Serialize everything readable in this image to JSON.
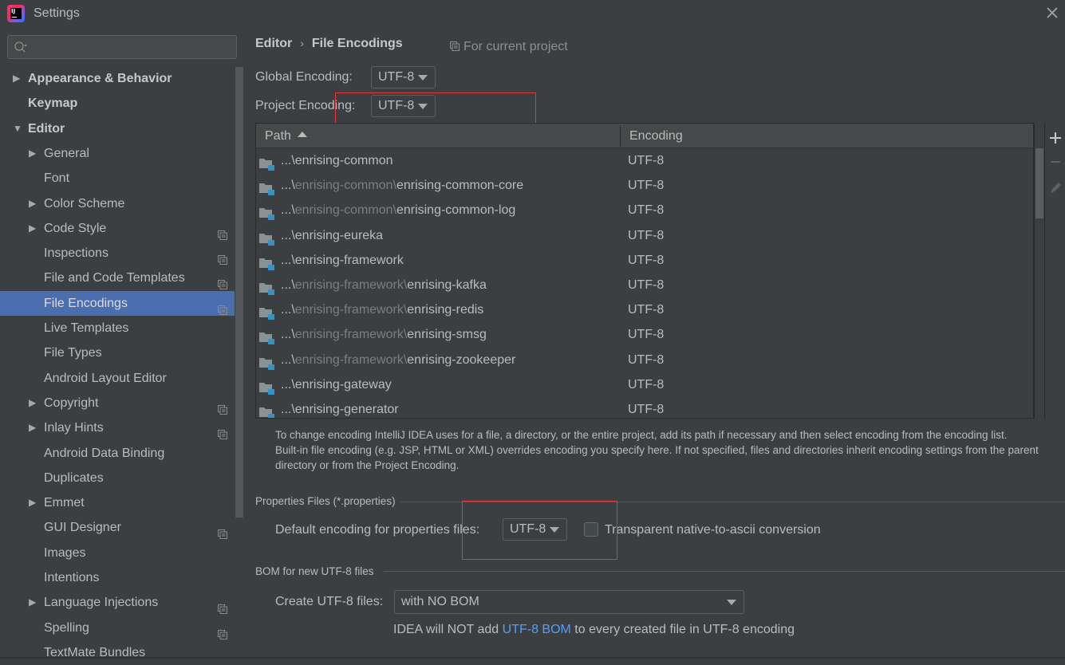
{
  "window": {
    "title": "Settings",
    "close_icon": "close-icon"
  },
  "search": {
    "placeholder": "",
    "value": ""
  },
  "sidebar": {
    "items": [
      {
        "label": "Appearance & Behavior",
        "level": 0,
        "bold": true,
        "expandable": true,
        "expanded": false,
        "project_scoped": false
      },
      {
        "label": "Keymap",
        "level": 0,
        "bold": true,
        "expandable": false,
        "project_scoped": false
      },
      {
        "label": "Editor",
        "level": 0,
        "bold": true,
        "expandable": true,
        "expanded": true,
        "project_scoped": false
      },
      {
        "label": "General",
        "level": 1,
        "expandable": true,
        "expanded": false,
        "project_scoped": false
      },
      {
        "label": "Font",
        "level": 1,
        "expandable": false,
        "project_scoped": false
      },
      {
        "label": "Color Scheme",
        "level": 1,
        "expandable": true,
        "expanded": false,
        "project_scoped": false
      },
      {
        "label": "Code Style",
        "level": 1,
        "expandable": true,
        "expanded": false,
        "project_scoped": true
      },
      {
        "label": "Inspections",
        "level": 1,
        "expandable": false,
        "project_scoped": true
      },
      {
        "label": "File and Code Templates",
        "level": 1,
        "expandable": false,
        "project_scoped": true
      },
      {
        "label": "File Encodings",
        "level": 1,
        "expandable": false,
        "project_scoped": true,
        "selected": true
      },
      {
        "label": "Live Templates",
        "level": 1,
        "expandable": false,
        "project_scoped": false
      },
      {
        "label": "File Types",
        "level": 1,
        "expandable": false,
        "project_scoped": false
      },
      {
        "label": "Android Layout Editor",
        "level": 1,
        "expandable": false,
        "project_scoped": false
      },
      {
        "label": "Copyright",
        "level": 1,
        "expandable": true,
        "expanded": false,
        "project_scoped": true
      },
      {
        "label": "Inlay Hints",
        "level": 1,
        "expandable": true,
        "expanded": false,
        "project_scoped": true
      },
      {
        "label": "Android Data Binding",
        "level": 1,
        "expandable": false,
        "project_scoped": false
      },
      {
        "label": "Duplicates",
        "level": 1,
        "expandable": false,
        "project_scoped": false
      },
      {
        "label": "Emmet",
        "level": 1,
        "expandable": true,
        "expanded": false,
        "project_scoped": false
      },
      {
        "label": "GUI Designer",
        "level": 1,
        "expandable": false,
        "project_scoped": true
      },
      {
        "label": "Images",
        "level": 1,
        "expandable": false,
        "project_scoped": false
      },
      {
        "label": "Intentions",
        "level": 1,
        "expandable": false,
        "project_scoped": false
      },
      {
        "label": "Language Injections",
        "level": 1,
        "expandable": true,
        "expanded": false,
        "project_scoped": true
      },
      {
        "label": "Spelling",
        "level": 1,
        "expandable": false,
        "project_scoped": true
      },
      {
        "label": "TextMate Bundles",
        "level": 1,
        "expandable": false,
        "project_scoped": false
      }
    ]
  },
  "header": {
    "breadcrumb_parent": "Editor",
    "breadcrumb_separator": "›",
    "breadcrumb_current": "File Encodings",
    "scope_note": "For current project"
  },
  "encoding": {
    "global_label": "Global Encoding:",
    "global_value": "UTF-8",
    "project_label": "Project Encoding:",
    "project_value": "UTF-8"
  },
  "table": {
    "columns": [
      {
        "label": "Path",
        "sort": "ascending"
      },
      {
        "label": "Encoding"
      }
    ],
    "rows": [
      {
        "prefix": "...\\",
        "dim": "",
        "name": "enrising-common",
        "encoding": "UTF-8"
      },
      {
        "prefix": "...\\",
        "dim": "enrising-common\\",
        "name": "enrising-common-core",
        "encoding": "UTF-8"
      },
      {
        "prefix": "...\\",
        "dim": "enrising-common\\",
        "name": "enrising-common-log",
        "encoding": "UTF-8"
      },
      {
        "prefix": "...\\",
        "dim": "",
        "name": "enrising-eureka",
        "encoding": "UTF-8"
      },
      {
        "prefix": "...\\",
        "dim": "",
        "name": "enrising-framework",
        "encoding": "UTF-8"
      },
      {
        "prefix": "...\\",
        "dim": "enrising-framework\\",
        "name": "enrising-kafka",
        "encoding": "UTF-8"
      },
      {
        "prefix": "...\\",
        "dim": "enrising-framework\\",
        "name": "enrising-redis",
        "encoding": "UTF-8"
      },
      {
        "prefix": "...\\",
        "dim": "enrising-framework\\",
        "name": "enrising-smsg",
        "encoding": "UTF-8"
      },
      {
        "prefix": "...\\",
        "dim": "enrising-framework\\",
        "name": "enrising-zookeeper",
        "encoding": "UTF-8"
      },
      {
        "prefix": "...\\",
        "dim": "",
        "name": "enrising-gateway",
        "encoding": "UTF-8"
      },
      {
        "prefix": "...\\",
        "dim": "",
        "name": "enrising-generator",
        "encoding": "UTF-8"
      }
    ],
    "tools": [
      "plus-icon",
      "minus-icon",
      "pencil-icon"
    ]
  },
  "help": {
    "line1": "To change encoding IntelliJ IDEA uses for a file, a directory, or the entire project, add its path if necessary and then select encoding from the encoding list.",
    "line2": "Built-in file encoding (e.g. JSP, HTML or XML) overrides encoding you specify here. If not specified, files and directories inherit encoding settings from the parent directory or from the Project Encoding."
  },
  "properties": {
    "group_title": "Properties Files (*.properties)",
    "default_label": "Default encoding for properties files:",
    "default_value": "UTF-8",
    "native_to_ascii_label": "Transparent native-to-ascii conversion",
    "native_to_ascii_checked": false
  },
  "bom": {
    "group_title": "BOM for new UTF-8 files",
    "create_label": "Create UTF-8 files:",
    "create_value": "with NO BOM",
    "note_before": "IDEA will NOT add ",
    "note_link": "UTF-8 BOM",
    "note_after": " to every created file in UTF-8 encoding"
  },
  "colors": {
    "background": "#3c3f41",
    "selection": "#4b6eaf",
    "link": "#589df6",
    "highlight_box": "#e8373b",
    "folder_badge": "#3592c4"
  }
}
